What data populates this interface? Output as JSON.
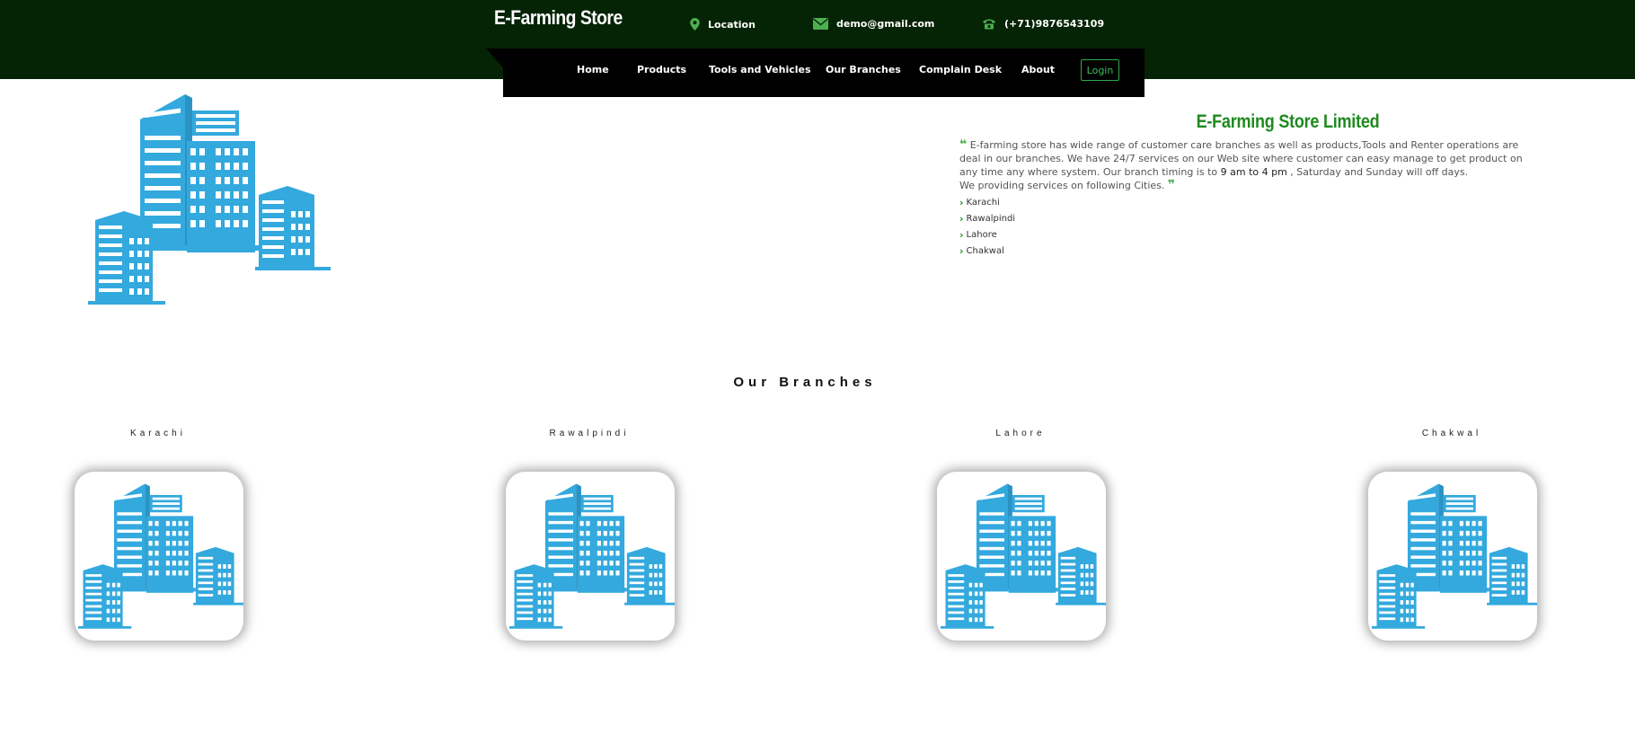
{
  "brand": {
    "name": "E-Farming Store"
  },
  "contacts": {
    "location": "Location",
    "email": "demo@gmail.com",
    "phone": "(+71)9876543109"
  },
  "nav": {
    "items": [
      "Home",
      "Products",
      "Tools and Vehicles",
      "Our Branches",
      "Complain Desk",
      "About"
    ],
    "login": "Login"
  },
  "about": {
    "title": "E-Farming Store Limited",
    "text_1": "E-farming store has wide range of customer care branches as well as products,Tools and Renter operations are deal in our branches. We have 24/7 services on our Web site where customer can easy manage to get product on any time any where system. Our branch timing is to ",
    "text_highlight": "9 am to 4 pm",
    "text_2": " , Saturday and Sunday will off days.",
    "text_3": "We providing services on following Cities.",
    "cities": [
      "Karachi",
      "Rawalpindi",
      "Lahore",
      "Chakwal"
    ]
  },
  "branches": {
    "title": "Our Branches",
    "items": [
      "Karachi",
      "Rawalpindi",
      "Lahore",
      "Chakwal"
    ]
  },
  "colors": {
    "header_bg": "#052305",
    "nav_bg": "#000000",
    "accent_green": "#1f8a1f",
    "icon_green": "#4caf50",
    "building_blue": "#33a9de"
  },
  "icons": {
    "location": "map-pin-icon",
    "email": "envelope-icon",
    "phone": "phone-icon",
    "quote_open": "quote-open-icon",
    "quote_close": "quote-close-icon",
    "chevron": "chevron-right-icon",
    "building": "buildings-image"
  }
}
